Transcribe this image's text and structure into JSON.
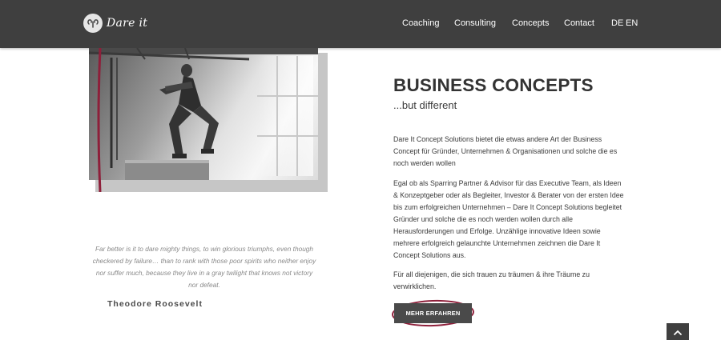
{
  "header": {
    "logo_text": "Dare it",
    "nav": [
      {
        "label": "Coaching"
      },
      {
        "label": "Consulting"
      },
      {
        "label": "Concepts"
      },
      {
        "label": "Contact"
      }
    ],
    "languages": [
      {
        "label": "DE"
      },
      {
        "label": "EN"
      }
    ]
  },
  "main": {
    "headline": "BUSINESS CONCEPTS",
    "subheadline": "...but different",
    "paragraphs": [
      "Dare It Concept Solutions bietet die etwas andere Art der Business Concept für Gründer, Unternehmen & Organisationen und solche die es noch werden wollen",
      "Egal ob als Sparring Partner & Advisor für das Executive Team, als Ideen & Konzeptgeber oder als Begleiter, Investor & Berater von der ersten Idee bis zum erfolgreichen Unternehmen – Dare It Concept Solutions begleitet Gründer und solche die es noch werden wollen durch alle Herausforderungen und Erfolge. Unzählige innovative Ideen sowie mehrere erfolgreich gelaunchte Unternehmen zeichnen die Dare It Concept Solutions aus.",
      "Für all diejenigen, die sich trauen zu träumen & ihre Träume zu verwirklichen."
    ],
    "cta_label": "MEHR ERFAHREN"
  },
  "quote": {
    "text": "Far better is it to dare mighty things, to win glorious triumphs, even though checkered by failure… than to rank with those poor spirits who neither enjoy nor suffer much, because they live in a gray twilight that knows not victory nor defeat.",
    "author": "Theodore Roosevelt"
  },
  "colors": {
    "header_bg": "#3f3f3f",
    "accent": "#8e1f3a",
    "button_bg": "#4a4a4a"
  },
  "icons": {
    "logo": "ram-head-icon",
    "scroll_top": "chevron-up-icon"
  }
}
